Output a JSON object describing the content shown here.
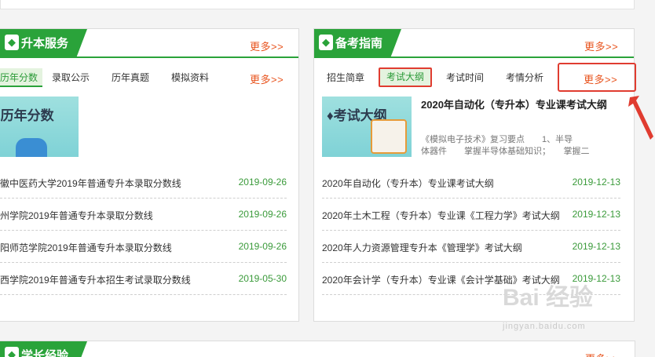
{
  "left_panel": {
    "title": "升本服务",
    "icon": "book-icon",
    "more": "更多>>",
    "tabs": [
      "历年分数",
      "录取公示",
      "历年真题",
      "模拟资料"
    ],
    "tabs_more": "更多>>",
    "thumb_title": "♦历年分数",
    "rows": [
      {
        "text": "徽中医药大学2019年普通专升本录取分数线",
        "date": "2019-09-26"
      },
      {
        "text": "州学院2019年普通专升本录取分数线",
        "date": "2019-09-26"
      },
      {
        "text": "阳师范学院2019年普通专升本录取分数线",
        "date": "2019-09-26"
      },
      {
        "text": "西学院2019年普通专升本招生考试录取分数线",
        "date": "2019-05-30"
      }
    ]
  },
  "right_panel": {
    "title": "备考指南",
    "icon": "book-icon",
    "more": "更多>>",
    "tabs": [
      "招生简章",
      "考试大纲",
      "考试时间",
      "考情分析"
    ],
    "tabs_more": "更多>>",
    "thumb_title": "♦考试大纲",
    "feature_title": "2020年自动化（专升本）专业课考试大纲",
    "feature_desc_line1": "《模拟电子技术》复习要点　　1、半导",
    "feature_desc_line2": "体器件　　掌握半导体基础知识；　　掌握二",
    "rows": [
      {
        "text": "2020年自动化（专升本）专业课考试大纲",
        "date": "2019-12-13"
      },
      {
        "text": "2020年土木工程（专升本）专业课《工程力学》考试大纲",
        "date": "2019-12-13"
      },
      {
        "text": "2020年人力资源管理专升本《管理学》考试大纲",
        "date": "2019-12-13"
      },
      {
        "text": "2020年会计学（专升本）专业课《会计学基础》考试大纲",
        "date": "2019-12-13"
      }
    ]
  },
  "bottom_panel": {
    "title": "学长经验",
    "more": "更多>>"
  },
  "watermark": {
    "brand": "Bai 经验",
    "url": "jingyan.baidu.com"
  },
  "colors": {
    "accent_green": "#2aa33a",
    "more_orange": "#e8541e",
    "highlight_red": "#e03c30",
    "date_green": "#3a9a3a"
  }
}
